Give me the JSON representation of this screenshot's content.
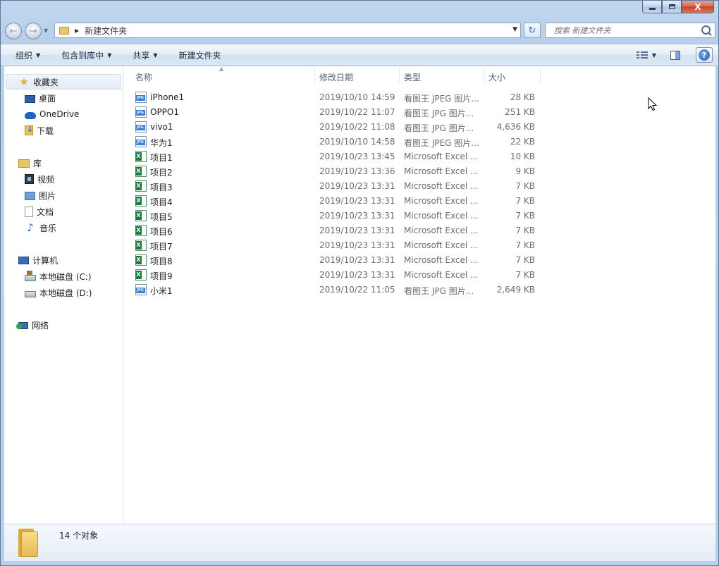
{
  "window": {
    "controls": {
      "close_label": "X"
    }
  },
  "nav": {
    "back_arrow": "←",
    "forward_arrow": "→",
    "address": {
      "breadcrumb": "新建文件夹"
    },
    "refresh_symbol": "↻",
    "search": {
      "placeholder": "搜索 新建文件夹"
    }
  },
  "toolbar": {
    "organize": "组织",
    "include_in_library": "包含到库中",
    "share": "共享",
    "new_folder": "新建文件夹",
    "help_symbol": "?"
  },
  "sidebar": {
    "favorites": {
      "label": "收藏夹",
      "items": [
        "桌面",
        "OneDrive",
        "下载"
      ]
    },
    "libraries": {
      "label": "库",
      "items": [
        "视频",
        "图片",
        "文档",
        "音乐"
      ]
    },
    "computer": {
      "label": "计算机",
      "items": [
        "本地磁盘 (C:)",
        "本地磁盘 (D:)"
      ]
    },
    "network": {
      "label": "网络"
    }
  },
  "file_list": {
    "columns": [
      "名称",
      "修改日期",
      "类型",
      "大小"
    ],
    "rows": [
      {
        "icon": "jpg-file-icon",
        "name": "iPhone1",
        "date": "2019/10/10 14:59",
        "type": "看图王 JPEG 图片...",
        "size": "28 KB"
      },
      {
        "icon": "jpg-file-icon",
        "name": "OPPO1",
        "date": "2019/10/22 11:07",
        "type": "看图王 JPG 图片...",
        "size": "251 KB"
      },
      {
        "icon": "jpg-file-icon",
        "name": "vivo1",
        "date": "2019/10/22 11:08",
        "type": "看图王 JPG 图片...",
        "size": "4,636 KB"
      },
      {
        "icon": "jpg-file-icon",
        "name": "华为1",
        "date": "2019/10/10 14:58",
        "type": "看图王 JPEG 图片...",
        "size": "22 KB"
      },
      {
        "icon": "excel-file-icon",
        "name": "项目1",
        "date": "2019/10/23 13:45",
        "type": "Microsoft Excel ...",
        "size": "10 KB"
      },
      {
        "icon": "excel-file-icon",
        "name": "项目2",
        "date": "2019/10/23 13:36",
        "type": "Microsoft Excel ...",
        "size": "9 KB"
      },
      {
        "icon": "excel-file-icon",
        "name": "项目3",
        "date": "2019/10/23 13:31",
        "type": "Microsoft Excel ...",
        "size": "7 KB"
      },
      {
        "icon": "excel-file-icon",
        "name": "项目4",
        "date": "2019/10/23 13:31",
        "type": "Microsoft Excel ...",
        "size": "7 KB"
      },
      {
        "icon": "excel-file-icon",
        "name": "项目5",
        "date": "2019/10/23 13:31",
        "type": "Microsoft Excel ...",
        "size": "7 KB"
      },
      {
        "icon": "excel-file-icon",
        "name": "项目6",
        "date": "2019/10/23 13:31",
        "type": "Microsoft Excel ...",
        "size": "7 KB"
      },
      {
        "icon": "excel-file-icon",
        "name": "项目7",
        "date": "2019/10/23 13:31",
        "type": "Microsoft Excel ...",
        "size": "7 KB"
      },
      {
        "icon": "excel-file-icon",
        "name": "项目8",
        "date": "2019/10/23 13:31",
        "type": "Microsoft Excel ...",
        "size": "7 KB"
      },
      {
        "icon": "excel-file-icon",
        "name": "项目9",
        "date": "2019/10/23 13:31",
        "type": "Microsoft Excel ...",
        "size": "7 KB"
      },
      {
        "icon": "jpg-file-icon",
        "name": "小米1",
        "date": "2019/10/22 11:05",
        "type": "看图王 JPG 图片...",
        "size": "2,649 KB"
      }
    ]
  },
  "details": {
    "count": "14 个对象"
  }
}
